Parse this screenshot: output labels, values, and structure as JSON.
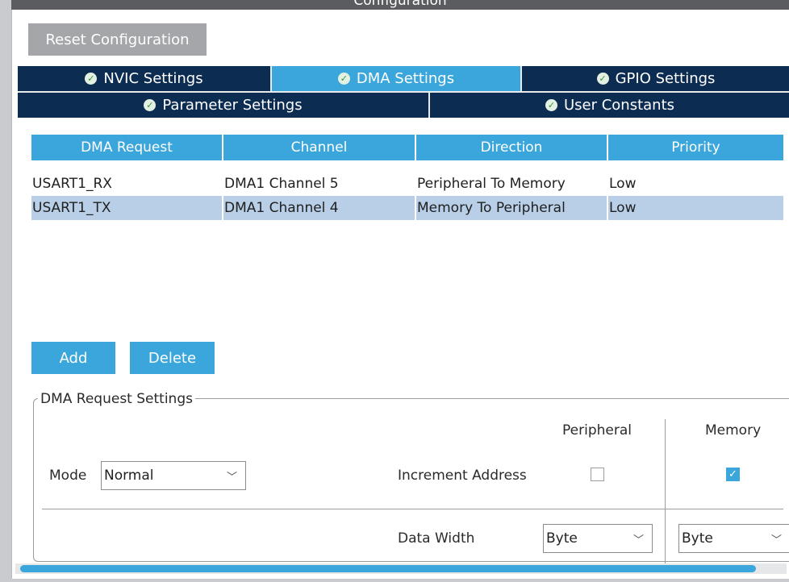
{
  "window": {
    "title": "Configuration"
  },
  "toolbar": {
    "reset_label": "Reset Configuration"
  },
  "tabs": [
    {
      "label": "NVIC Settings",
      "active": false
    },
    {
      "label": "DMA Settings",
      "active": true
    },
    {
      "label": "GPIO Settings",
      "active": false
    },
    {
      "label": "Parameter Settings",
      "active": false
    },
    {
      "label": "User Constants",
      "active": false
    }
  ],
  "table": {
    "headers": [
      "DMA Request",
      "Channel",
      "Direction",
      "Priority"
    ],
    "rows": [
      [
        "USART1_RX",
        "DMA1 Channel 5",
        "Peripheral To Memory",
        "Low"
      ],
      [
        "USART1_TX",
        "DMA1 Channel 4",
        "Memory To Peripheral",
        "Low"
      ]
    ],
    "selected_row": 1
  },
  "actions": {
    "add_label": "Add",
    "delete_label": "Delete"
  },
  "settings": {
    "group_title": "DMA Request Settings",
    "peripheral_header": "Peripheral",
    "memory_header": "Memory",
    "mode_label": "Mode",
    "mode_value": "Normal",
    "increment_label": "Increment Address",
    "peripheral_increment": false,
    "memory_increment": true,
    "data_width_label": "Data Width",
    "peripheral_width": "Byte",
    "memory_width": "Byte"
  },
  "icons": {
    "check": "check-circle-icon",
    "chevron": "chevron-down-icon",
    "checkmark": "checkmark-icon"
  },
  "colors": {
    "accent": "#3aa6db",
    "tab_dark": "#0d2c52",
    "selected_row": "#b8cfe7",
    "disabled_button": "#a4a6a9"
  }
}
